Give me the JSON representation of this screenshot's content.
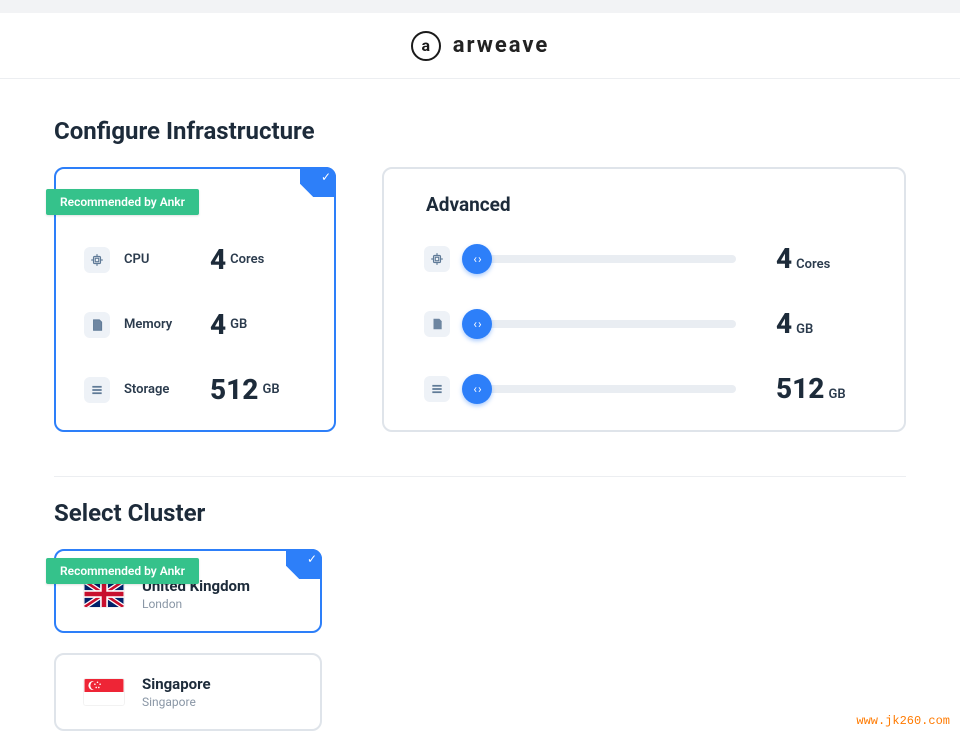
{
  "brand": {
    "logo_letter": "a",
    "name": "arweave"
  },
  "sections": {
    "configure": "Configure Infrastructure",
    "cluster": "Select Cluster"
  },
  "recommended_badge": "Recommended by Ankr",
  "preset": {
    "cpu": {
      "label": "CPU",
      "value": "4",
      "unit": "Cores"
    },
    "memory": {
      "label": "Memory",
      "value": "4",
      "unit": "GB"
    },
    "storage": {
      "label": "Storage",
      "value": "512",
      "unit": "GB"
    }
  },
  "advanced": {
    "title": "Advanced",
    "cpu": {
      "value": "4",
      "unit": "Cores"
    },
    "memory": {
      "value": "4",
      "unit": "GB"
    },
    "storage": {
      "value": "512",
      "unit": "GB"
    }
  },
  "clusters": {
    "uk": {
      "name": "United Kingdom",
      "city": "London"
    },
    "sg": {
      "name": "Singapore",
      "city": "Singapore"
    }
  },
  "watermark": "www.jk260.com"
}
